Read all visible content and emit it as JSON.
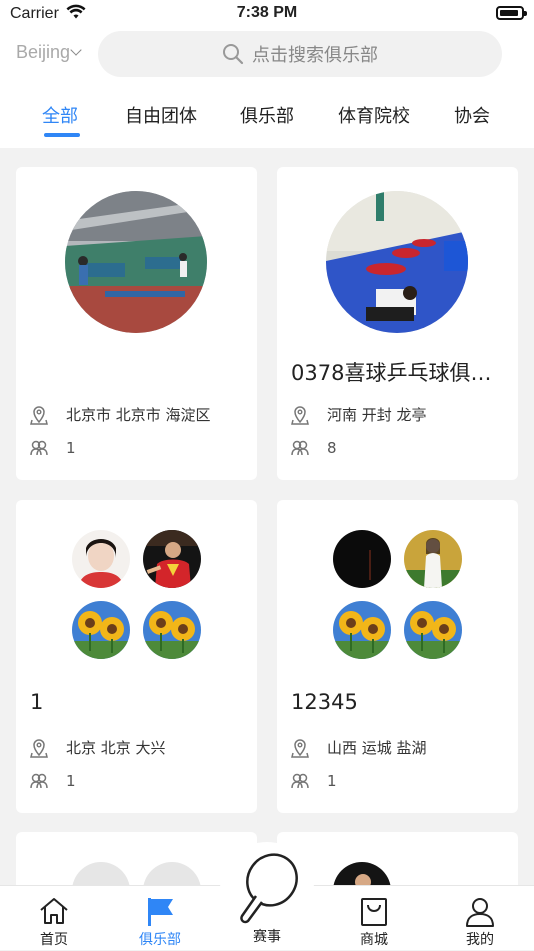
{
  "status": {
    "carrier": "Carrier",
    "time": "7:38 PM"
  },
  "header": {
    "city": "Beijing",
    "search_placeholder": "点击搜索俱乐部"
  },
  "tabs": [
    {
      "label": "全部",
      "active": true
    },
    {
      "label": "自由团体",
      "active": false
    },
    {
      "label": "俱乐部",
      "active": false
    },
    {
      "label": "体育院校",
      "active": false
    },
    {
      "label": "协会",
      "active": false
    }
  ],
  "cards": [
    {
      "title": "",
      "location": "北京市 北京市 海淀区",
      "members": "1"
    },
    {
      "title": "0378喜球乒乓球俱…",
      "location": "河南 开封 龙亭",
      "members": "8"
    },
    {
      "title": "1",
      "location": "北京 北京 大兴",
      "members": "1"
    },
    {
      "title": "12345",
      "location": "山西 运城 盐湖",
      "members": "1"
    }
  ],
  "bottom_nav": [
    {
      "label": "首页",
      "icon": "home-icon",
      "active": false
    },
    {
      "label": "俱乐部",
      "icon": "flag-icon",
      "active": true
    },
    {
      "label": "赛事",
      "icon": "ping-pong-paddle-icon",
      "active": false
    },
    {
      "label": "商城",
      "icon": "shopping-bag-icon",
      "active": false
    },
    {
      "label": "我的",
      "icon": "user-icon",
      "active": false
    }
  ],
  "colors": {
    "accent": "#2f86f6",
    "background": "#f2f2f2"
  }
}
